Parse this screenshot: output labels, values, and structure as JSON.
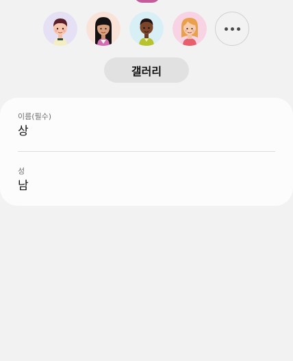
{
  "avatars": {
    "items": [
      {
        "icon": "boy-avatar-icon",
        "bg": "#e6e0f4"
      },
      {
        "icon": "woman-avatar-icon",
        "bg": "#f9e3d8"
      },
      {
        "icon": "man-avatar-icon",
        "bg": "#d8eff6"
      },
      {
        "icon": "girl-avatar-icon",
        "bg": "#f7d3e4"
      }
    ],
    "more_icon": "more-horizontal-icon"
  },
  "gallery_button_label": "갤러리",
  "form": {
    "name_label": "이름(필수)",
    "name_value": "상",
    "surname_label": "성",
    "surname_value": "남"
  },
  "colors": {
    "background": "#f3f2f3",
    "card": "#fcfcfc",
    "button": "#e2e1e2"
  }
}
